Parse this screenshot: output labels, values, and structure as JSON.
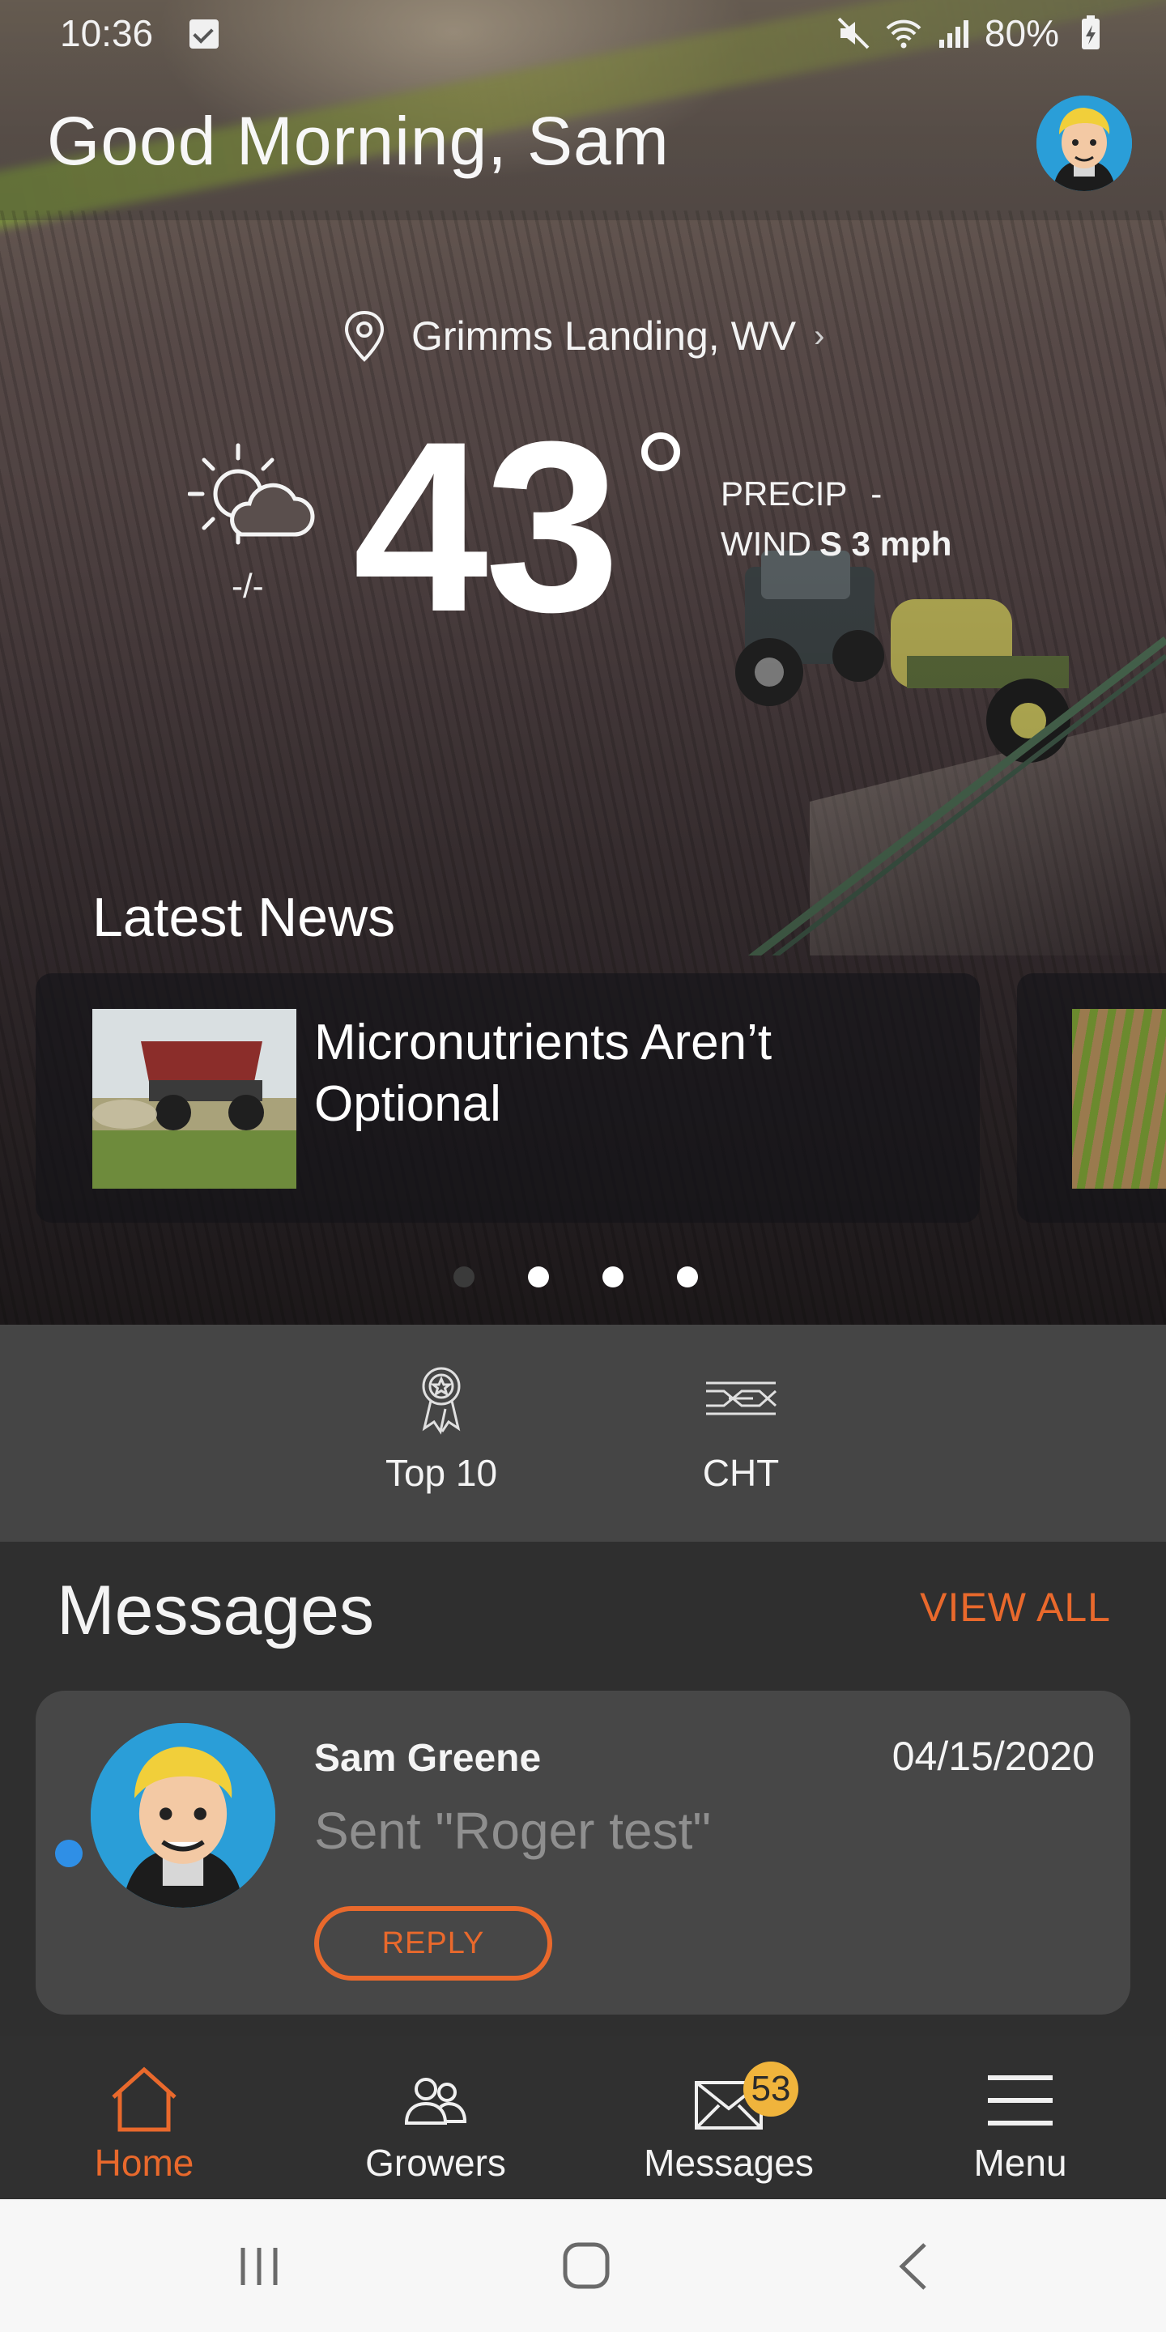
{
  "status_bar": {
    "time": "10:36",
    "battery": "80%"
  },
  "header": {
    "greeting": "Good Morning, Sam"
  },
  "weather": {
    "location": "Grimms Landing, WV",
    "temperature": "43",
    "hi_lo": "-/-",
    "precip_label": "PRECIP",
    "precip_value": "-",
    "wind_label": "WIND",
    "wind_value": "S 3 mph"
  },
  "news": {
    "title": "Latest News",
    "articles": [
      {
        "headline": "Micronutrients Aren’t Optional"
      }
    ],
    "page_count": 4,
    "active_page_index": 0
  },
  "quick_links": [
    {
      "label": "Top 10",
      "icon": "award-ribbon-icon"
    },
    {
      "label": "CHT",
      "icon": "cht-icon"
    }
  ],
  "messages": {
    "title": "Messages",
    "view_all_label": "VIEW ALL",
    "items": [
      {
        "sender": "Sam Greene",
        "date": "04/15/2020",
        "body": "Sent \"Roger test\"",
        "reply_label": "REPLY",
        "unread": true
      }
    ]
  },
  "bottom_nav": {
    "items": [
      {
        "label": "Home",
        "icon": "home-icon",
        "active": true
      },
      {
        "label": "Growers",
        "icon": "growers-icon",
        "active": false
      },
      {
        "label": "Messages",
        "icon": "envelope-icon",
        "active": false,
        "badge": "53"
      },
      {
        "label": "Menu",
        "icon": "hamburger-menu-icon",
        "active": false
      }
    ]
  },
  "colors": {
    "accent": "#e9692c",
    "badge": "#f0b43c",
    "unread_dot": "#2f8fe6"
  }
}
